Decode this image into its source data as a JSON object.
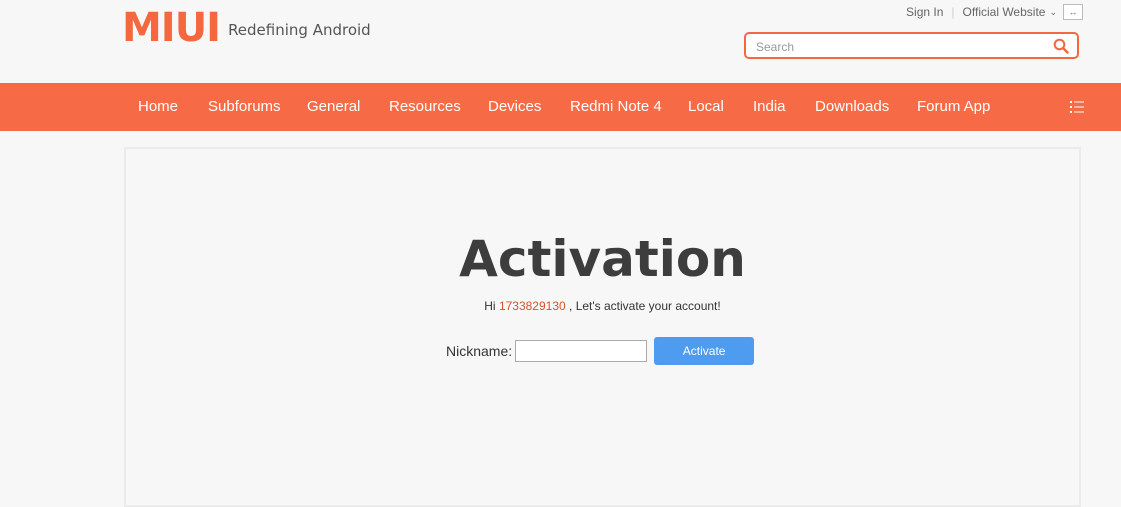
{
  "header": {
    "logo_text": "MIUI",
    "tagline": "Redefining Android",
    "sign_in": "Sign In",
    "separator": "|",
    "official_website": "Official Website",
    "search_placeholder": "Search"
  },
  "nav": {
    "items": [
      {
        "label": "Home"
      },
      {
        "label": "Subforums"
      },
      {
        "label": "General"
      },
      {
        "label": "Resources"
      },
      {
        "label": "Devices"
      },
      {
        "label": "Redmi Note 4"
      },
      {
        "label": "Local"
      },
      {
        "label": "India"
      },
      {
        "label": "Downloads"
      },
      {
        "label": "Forum App"
      }
    ]
  },
  "main": {
    "title": "Activation",
    "greeting_prefix": "Hi ",
    "user_id": "1733829130",
    "greeting_suffix": " , Let's activate your account!",
    "nickname_label": "Nickname:",
    "nickname_value": "",
    "activate_label": "Activate"
  },
  "colors": {
    "accent": "#f66b45",
    "button": "#4d9cf0",
    "title": "#3d3d3d"
  }
}
